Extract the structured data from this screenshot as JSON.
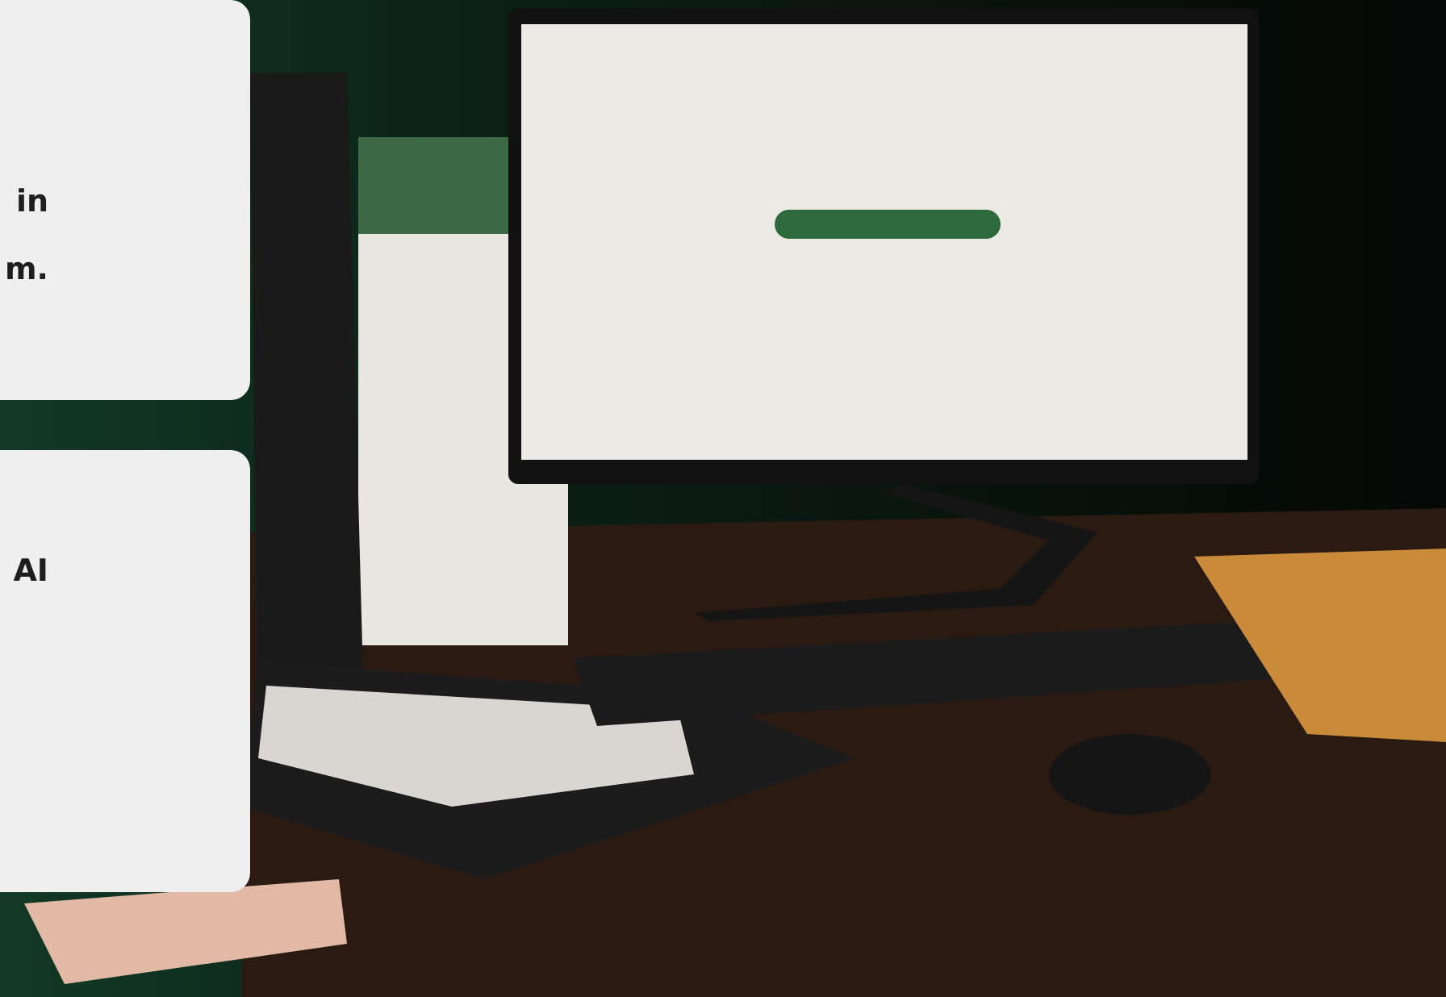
{
  "cards": [
    {
      "lines": [
        "in",
        "m."
      ]
    },
    {
      "lines": [
        "AI"
      ]
    }
  ]
}
